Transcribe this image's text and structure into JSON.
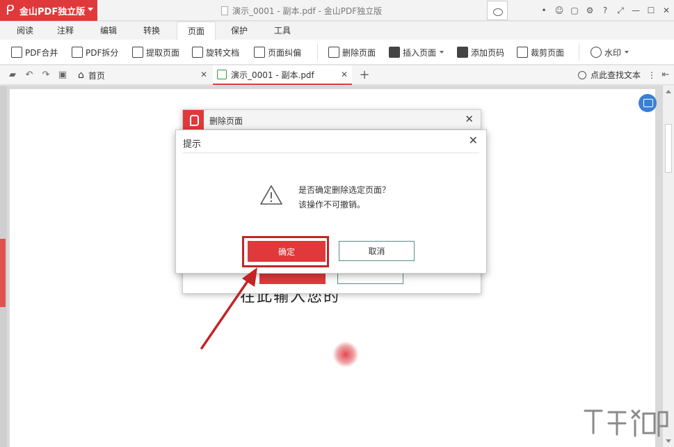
{
  "app": {
    "name": "金山PDF独立版",
    "window_title": "演示_0001 - 副本.pdf - 金山PDF独立版"
  },
  "menu_tabs": [
    {
      "label": "阅读"
    },
    {
      "label": "注释"
    },
    {
      "label": "编辑"
    },
    {
      "label": "转换"
    },
    {
      "label": "页面"
    },
    {
      "label": "保护"
    },
    {
      "label": "工具"
    }
  ],
  "ribbon": {
    "pdf_merge": "PDF合并",
    "pdf_split": "PDF拆分",
    "extract_page": "提取页面",
    "rotate_doc": "旋转文档",
    "page_deskew": "页面纠偏",
    "delete_page": "删除页面",
    "insert_page": "插入页面",
    "add_page_number": "添加页码",
    "crop_page": "裁剪页面",
    "watermark": "水印"
  },
  "tabs": {
    "home": "首页",
    "document": "演示_0001 - 副本.pdf",
    "search": "点此查找文本"
  },
  "dialog_back": {
    "title": "删除页面"
  },
  "dialog": {
    "title": "提示",
    "message_line1": "是否确定删除选定页面？",
    "message_line2": "该操作不可撤销。",
    "ok": "确定",
    "cancel": "取消"
  },
  "page_text": "在此输入您的",
  "colors": {
    "brand": "#e0393b",
    "highlight": "#c42424",
    "cancel_border": "#5a8a8a"
  }
}
